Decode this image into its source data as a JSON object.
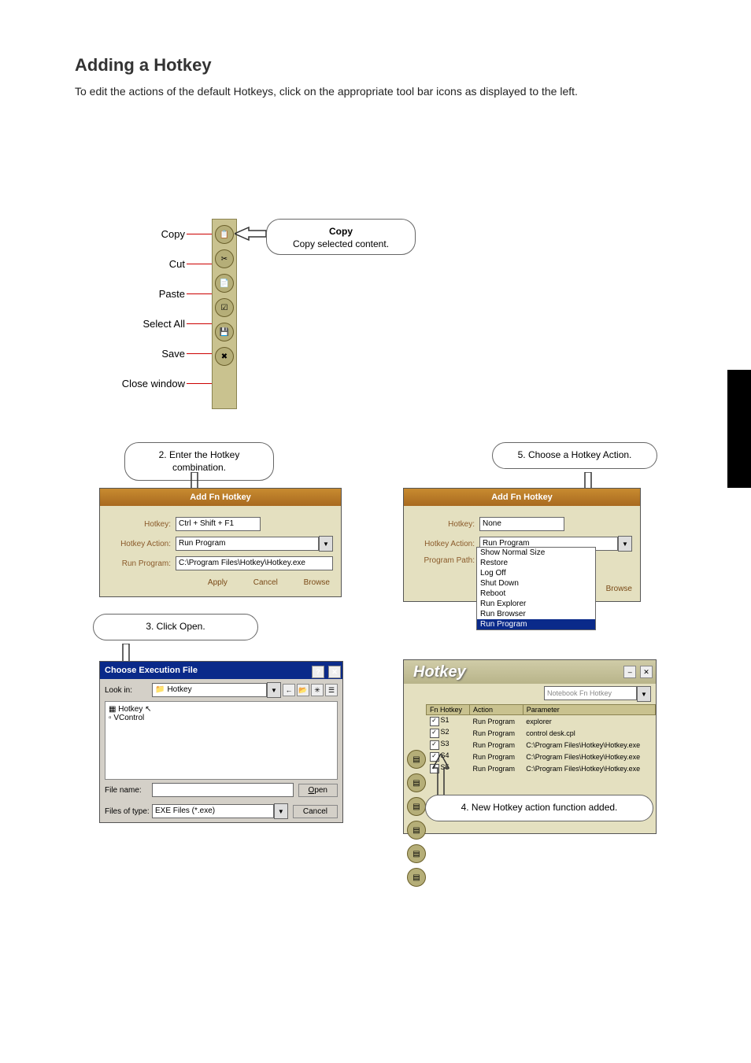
{
  "heading": "Adding a Hotkey",
  "intro_para": "To edit the actions of the default Hotkeys, click on the appropriate tool bar icons as displayed to the left.",
  "toolbar_items": [
    "Copy",
    "Cut",
    "Paste",
    "Select All",
    "Save",
    "Close window"
  ],
  "tooltip_copy": {
    "title": "Copy",
    "sub": "Copy selected content."
  },
  "dlg2": {
    "title": "Add Fn Hotkey",
    "hotkey_label": "Hotkey:",
    "hotkey_value": "Ctrl + Shift + F1",
    "action_label": "Hotkey Action:",
    "action_value": "Run Program",
    "run_label": "Run Program:",
    "run_value": "C:\\Program Files\\Hotkey\\Hotkey.exe",
    "buttons": [
      "Apply",
      "Cancel",
      "Browse"
    ],
    "callout": "2. Enter the Hotkey combination."
  },
  "dlg5": {
    "title": "Add Fn Hotkey",
    "hotkey_label": "Hotkey:",
    "hotkey_value": "None",
    "action_label": "Hotkey Action:",
    "action_value": "Run Program",
    "path_label": "Program Path:",
    "browse": "Browse",
    "options": [
      "Show Normal Size",
      "Restore",
      "Log Off",
      "Shut Down",
      "Reboot",
      "Run Explorer",
      "Run Browser",
      "Run Program"
    ],
    "callout": "5. Choose a Hotkey Action."
  },
  "dlg3": {
    "title": "Choose Execution File",
    "lookin_label": "Look in:",
    "lookin_value": "Hotkey",
    "files": [
      "Hotkey",
      "VControl"
    ],
    "filename_label": "File name:",
    "filename_value": "",
    "filetype_label": "Files of type:",
    "filetype_value": "EXE Files (*.exe)",
    "open": "Open",
    "cancel": "Cancel",
    "callout": "3. Click Open."
  },
  "dlg4": {
    "title": "Hotkey",
    "subselect": "Notebook Fn Hotkey",
    "cols": [
      "Fn Hotkey",
      "Action",
      "Parameter"
    ],
    "rows": [
      {
        "k": "S1",
        "a": "Run Program",
        "p": "explorer"
      },
      {
        "k": "S2",
        "a": "Run Program",
        "p": "control desk.cpl"
      },
      {
        "k": "S3",
        "a": "Run Program",
        "p": "C:\\Program Files\\Hotkey\\Hotkey.exe"
      },
      {
        "k": "S4",
        "a": "Run Program",
        "p": "C:\\Program Files\\Hotkey\\Hotkey.exe"
      },
      {
        "k": "S5",
        "a": "Run Program",
        "p": "C:\\Program Files\\Hotkey\\Hotkey.exe"
      }
    ],
    "callout": "4. New Hotkey action function added."
  }
}
